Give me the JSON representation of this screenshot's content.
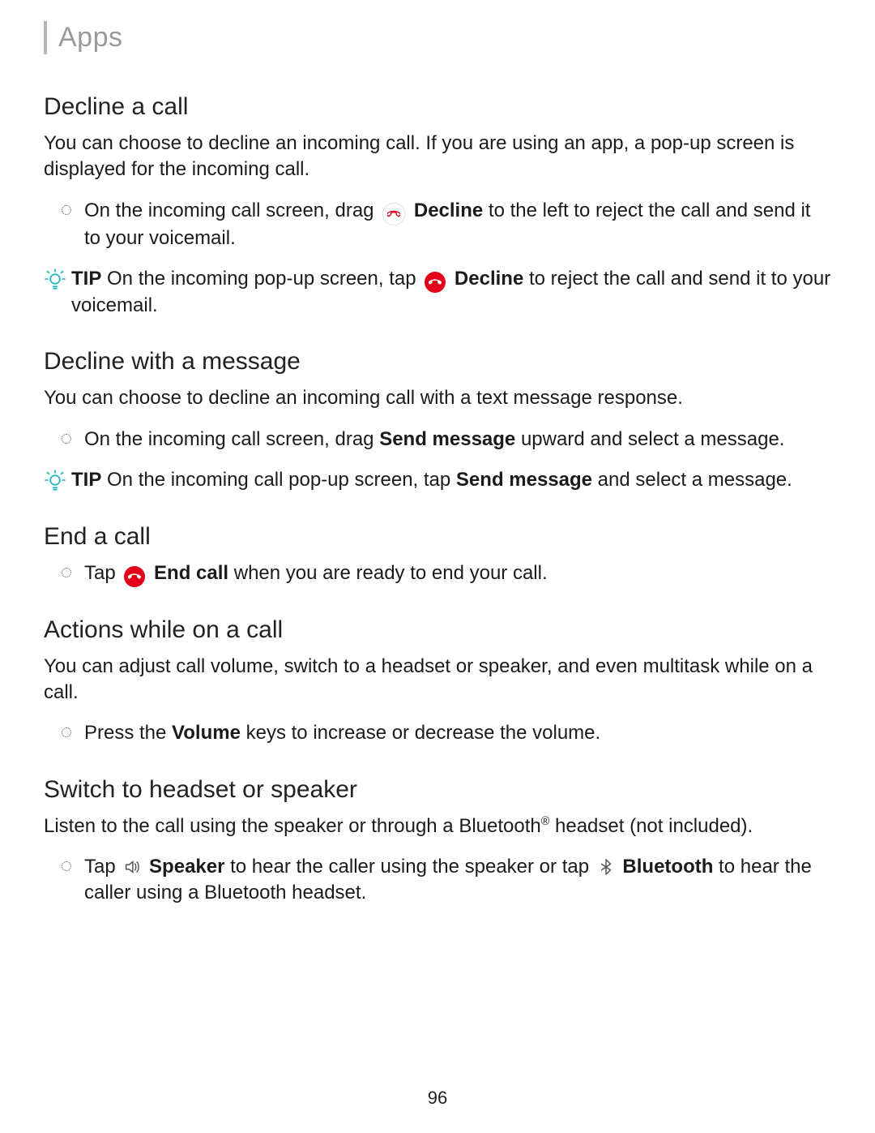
{
  "breadcrumb": {
    "title": "Apps"
  },
  "pageNumber": "96",
  "s1": {
    "heading": "Decline a call",
    "intro": "You can choose to decline an incoming call. If you are using an app, a pop-up screen is displayed for the incoming call.",
    "b1_a": "On the incoming call screen, drag ",
    "b1_bold": "Decline",
    "b1_b": " to the left to reject the call and send it to your voicemail.",
    "tip_label": "TIP",
    "tip_a": "  On the incoming pop-up screen, tap ",
    "tip_bold": "Decline",
    "tip_b": " to reject the call and send it to your voicemail."
  },
  "s2": {
    "heading": "Decline with a message",
    "intro": "You can choose to decline an incoming call with a text message response.",
    "b1_a": "On the incoming call screen, drag ",
    "b1_bold": "Send message",
    "b1_b": " upward and select a message.",
    "tip_label": "TIP",
    "tip_a": "  On the incoming call pop-up screen, tap ",
    "tip_bold": "Send message",
    "tip_b": " and select a message."
  },
  "s3": {
    "heading": "End a call",
    "b1_a": "Tap ",
    "b1_bold": "End call",
    "b1_b": " when you are ready to end your call."
  },
  "s4": {
    "heading": "Actions while on a call",
    "intro": "You can adjust call volume, switch to a headset or speaker, and even multitask while on a call.",
    "b1_a": "Press the ",
    "b1_bold": "Volume",
    "b1_b": " keys to increase or decrease the volume."
  },
  "s5": {
    "heading": "Switch to headset or speaker",
    "intro_a": "Listen to the call using the speaker or through a Bluetooth",
    "intro_sup": "®",
    "intro_b": " headset (not included).",
    "b1_a": "Tap ",
    "b1_bold1": "Speaker",
    "b1_b": " to hear the caller using the speaker or tap ",
    "b1_bold2": "Bluetooth",
    "b1_c": " to hear the caller using a Bluetooth headset."
  }
}
